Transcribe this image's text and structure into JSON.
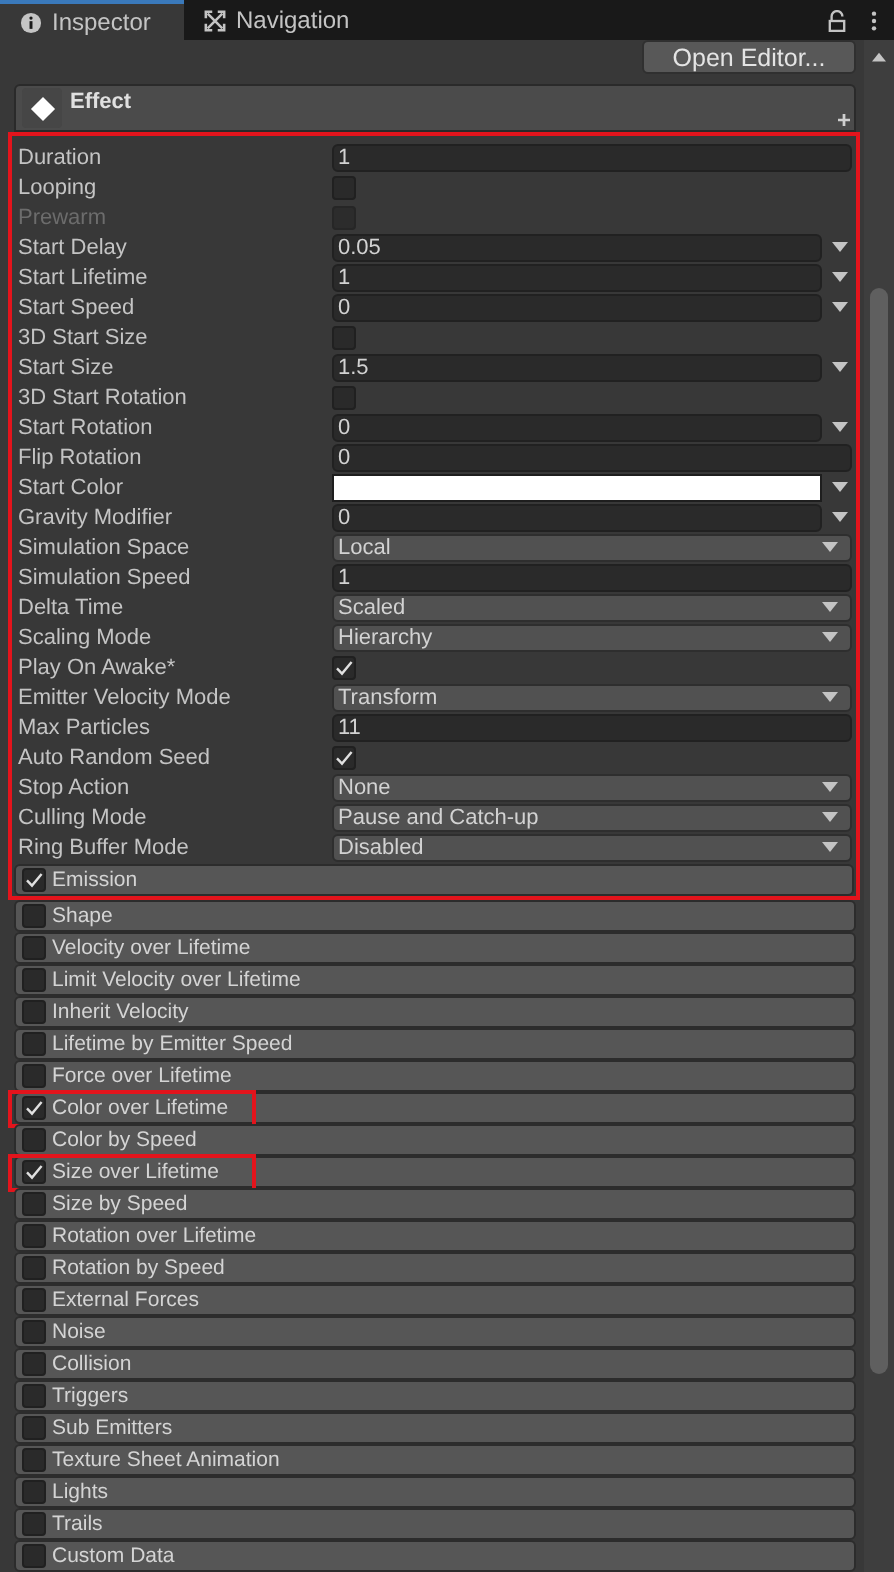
{
  "tabs": [
    {
      "label": "Inspector",
      "selected": true
    },
    {
      "label": "Navigation",
      "selected": false
    }
  ],
  "toolbar": {
    "button": "Open Editor..."
  },
  "component": {
    "title": "Effect"
  },
  "main_section": {
    "highlighted": true,
    "properties": [
      {
        "label": "Duration",
        "kind": "number",
        "value": "1",
        "disabled": false
      },
      {
        "label": "Looping",
        "kind": "checkbox",
        "checked": false,
        "disabled": false
      },
      {
        "label": "Prewarm",
        "kind": "checkbox",
        "checked": false,
        "disabled": true
      },
      {
        "label": "Start Delay",
        "kind": "minmax",
        "value": "0.05",
        "disabled": false
      },
      {
        "label": "Start Lifetime",
        "kind": "minmax",
        "value": "1",
        "disabled": false
      },
      {
        "label": "Start Speed",
        "kind": "minmax",
        "value": "0",
        "disabled": false
      },
      {
        "label": "3D Start Size",
        "kind": "checkbox",
        "checked": false,
        "disabled": false
      },
      {
        "label": "Start Size",
        "kind": "minmax",
        "value": "1.5",
        "disabled": false
      },
      {
        "label": "3D Start Rotation",
        "kind": "checkbox",
        "checked": false,
        "disabled": false
      },
      {
        "label": "Start Rotation",
        "kind": "minmax",
        "value": "0",
        "disabled": false
      },
      {
        "label": "Flip Rotation",
        "kind": "number",
        "value": "0",
        "disabled": false
      },
      {
        "label": "Start Color",
        "kind": "color",
        "color": "#ffffff",
        "disabled": false
      },
      {
        "label": "Gravity Modifier",
        "kind": "minmax",
        "value": "0",
        "disabled": false
      },
      {
        "label": "Simulation Space",
        "kind": "dropdown",
        "value": "Local",
        "disabled": false
      },
      {
        "label": "Simulation Speed",
        "kind": "number",
        "value": "1",
        "disabled": false
      },
      {
        "label": "Delta Time",
        "kind": "dropdown",
        "value": "Scaled",
        "disabled": false
      },
      {
        "label": "Scaling Mode",
        "kind": "dropdown",
        "value": "Hierarchy",
        "disabled": false
      },
      {
        "label": "Play On Awake*",
        "kind": "checkbox",
        "checked": true,
        "disabled": false
      },
      {
        "label": "Emitter Velocity Mode",
        "kind": "dropdown",
        "value": "Transform",
        "disabled": false
      },
      {
        "label": "Max Particles",
        "kind": "number",
        "value": "11",
        "disabled": false
      },
      {
        "label": "Auto Random Seed",
        "kind": "checkbox",
        "checked": true,
        "disabled": false
      },
      {
        "label": "Stop Action",
        "kind": "dropdown",
        "value": "None",
        "disabled": false
      },
      {
        "label": "Culling Mode",
        "kind": "dropdown",
        "value": "Pause and Catch-up",
        "disabled": false
      },
      {
        "label": "Ring Buffer Mode",
        "kind": "dropdown",
        "value": "Disabled",
        "disabled": false
      }
    ],
    "modules": [
      {
        "label": "Emission",
        "checked": true,
        "highlighted": false
      }
    ]
  },
  "modules": [
    {
      "label": "Shape",
      "checked": false,
      "highlighted": false
    },
    {
      "label": "Velocity over Lifetime",
      "checked": false,
      "highlighted": false
    },
    {
      "label": "Limit Velocity over Lifetime",
      "checked": false,
      "highlighted": false
    },
    {
      "label": "Inherit Velocity",
      "checked": false,
      "highlighted": false
    },
    {
      "label": "Lifetime by Emitter Speed",
      "checked": false,
      "highlighted": false
    },
    {
      "label": "Force over Lifetime",
      "checked": false,
      "highlighted": false
    },
    {
      "label": "Color over Lifetime",
      "checked": true,
      "highlighted": true
    },
    {
      "label": "Color by Speed",
      "checked": false,
      "highlighted": false
    },
    {
      "label": "Size over Lifetime",
      "checked": true,
      "highlighted": true
    },
    {
      "label": "Size by Speed",
      "checked": false,
      "highlighted": false
    },
    {
      "label": "Rotation over Lifetime",
      "checked": false,
      "highlighted": false
    },
    {
      "label": "Rotation by Speed",
      "checked": false,
      "highlighted": false
    },
    {
      "label": "External Forces",
      "checked": false,
      "highlighted": false
    },
    {
      "label": "Noise",
      "checked": false,
      "highlighted": false
    },
    {
      "label": "Collision",
      "checked": false,
      "highlighted": false
    },
    {
      "label": "Triggers",
      "checked": false,
      "highlighted": false
    },
    {
      "label": "Sub Emitters",
      "checked": false,
      "highlighted": false
    },
    {
      "label": "Texture Sheet Animation",
      "checked": false,
      "highlighted": false
    },
    {
      "label": "Lights",
      "checked": false,
      "highlighted": false
    },
    {
      "label": "Trails",
      "checked": false,
      "highlighted": false
    },
    {
      "label": "Custom Data",
      "checked": false,
      "highlighted": false
    }
  ]
}
